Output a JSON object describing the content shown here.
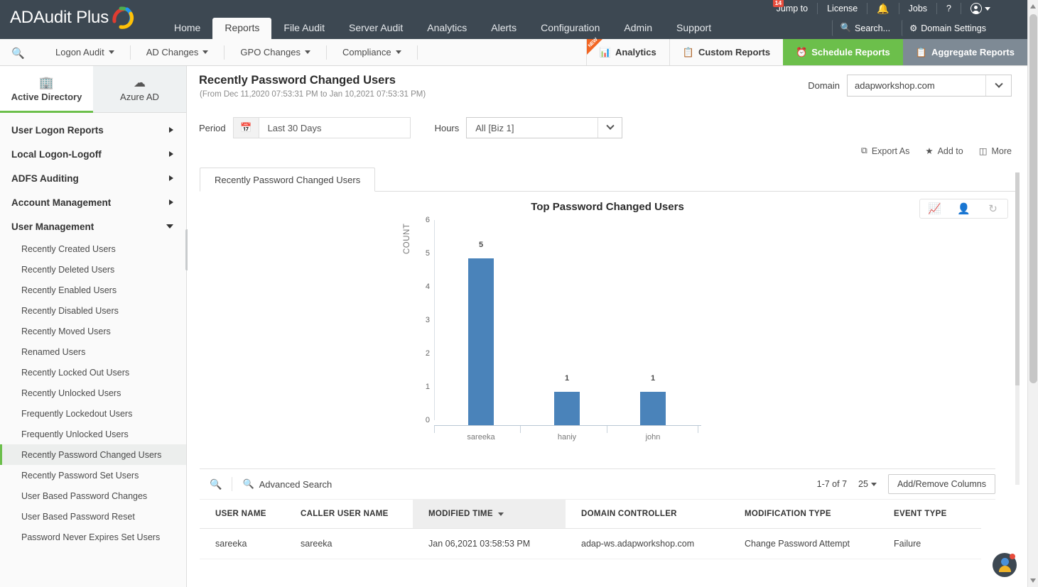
{
  "app": {
    "name": "ADAudit Plus"
  },
  "header": {
    "nav": [
      {
        "label": "Home",
        "active": false
      },
      {
        "label": "Reports",
        "active": true
      },
      {
        "label": "File Audit",
        "active": false
      },
      {
        "label": "Server Audit",
        "active": false
      },
      {
        "label": "Analytics",
        "active": false
      },
      {
        "label": "Alerts",
        "active": false
      },
      {
        "label": "Configuration",
        "active": false
      },
      {
        "label": "Admin",
        "active": false
      },
      {
        "label": "Support",
        "active": false
      }
    ],
    "utilities": [
      {
        "label": "Jump to"
      },
      {
        "label": "License"
      },
      {
        "label": "Jobs"
      },
      {
        "label": "?"
      }
    ],
    "notification_count": "14",
    "search_button": "Search...",
    "domain_settings_button": "Domain Settings"
  },
  "toolbar": {
    "menus": [
      {
        "label": "Logon Audit"
      },
      {
        "label": "AD Changes"
      },
      {
        "label": "GPO Changes"
      },
      {
        "label": "Compliance"
      }
    ],
    "right_items": [
      {
        "label": "Analytics",
        "badge": "NEW",
        "style": "plain"
      },
      {
        "label": "Custom Reports",
        "style": "plain"
      },
      {
        "label": "Schedule Reports",
        "style": "green"
      },
      {
        "label": "Aggregate Reports",
        "style": "grey"
      }
    ]
  },
  "sidebar": {
    "tabs": [
      {
        "label": "Active Directory",
        "active": true
      },
      {
        "label": "Azure AD",
        "active": false
      }
    ],
    "groups": [
      {
        "label": "User Logon Reports",
        "expanded": false
      },
      {
        "label": "Local Logon-Logoff",
        "expanded": false
      },
      {
        "label": "ADFS Auditing",
        "expanded": false
      },
      {
        "label": "Account Management",
        "expanded": false
      },
      {
        "label": "User Management",
        "expanded": true
      }
    ],
    "items": [
      {
        "label": "Recently Created Users",
        "active": false
      },
      {
        "label": "Recently Deleted Users",
        "active": false
      },
      {
        "label": "Recently Enabled Users",
        "active": false
      },
      {
        "label": "Recently Disabled Users",
        "active": false
      },
      {
        "label": "Recently Moved Users",
        "active": false
      },
      {
        "label": "Renamed Users",
        "active": false
      },
      {
        "label": "Recently Locked Out Users",
        "active": false
      },
      {
        "label": "Recently Unlocked Users",
        "active": false
      },
      {
        "label": "Frequently Lockedout Users",
        "active": false
      },
      {
        "label": "Frequently Unlocked Users",
        "active": false
      },
      {
        "label": "Recently Password Changed Users",
        "active": true
      },
      {
        "label": "Recently Password Set Users",
        "active": false
      },
      {
        "label": "User Based Password Changes",
        "active": false
      },
      {
        "label": "User Based Password Reset",
        "active": false
      },
      {
        "label": "Password Never Expires Set Users",
        "active": false
      }
    ]
  },
  "page": {
    "title": "Recently Password Changed Users",
    "subtitle": "(From Dec 11,2020 07:53:31 PM to Jan 10,2021 07:53:31 PM)",
    "domain_label": "Domain",
    "domain_value": "adapworkshop.com",
    "period_label": "Period",
    "period_value": "Last 30 Days",
    "hours_label": "Hours",
    "hours_value": "All [Biz 1]",
    "actions": [
      {
        "label": "Export As",
        "icon": "export-icon"
      },
      {
        "label": "Add to",
        "icon": "star-icon"
      },
      {
        "label": "More",
        "icon": "more-icon"
      }
    ],
    "card_tab": "Recently Password Changed Users"
  },
  "chart_data": {
    "type": "bar",
    "title": "Top Password Changed Users",
    "categories": [
      "sareeka",
      "haniy",
      "john"
    ],
    "values": [
      5,
      1,
      1
    ],
    "xlabel": "",
    "ylabel": "COUNT",
    "ylim": [
      0,
      6
    ],
    "yticks": [
      0,
      1,
      2,
      3,
      4,
      5,
      6
    ],
    "grid": false,
    "legend": "none",
    "bar_color": "#4a83ba",
    "data_labels": [
      "5",
      "1",
      "1"
    ]
  },
  "chart_tools": [
    {
      "icon": "add-chart-icon"
    },
    {
      "icon": "user-icon"
    },
    {
      "icon": "refresh-chart-icon"
    }
  ],
  "table": {
    "search_icon": "search-icon",
    "advanced_search": "Advanced Search",
    "count": "1-7 of 7",
    "page_size": "25",
    "add_remove_columns": "Add/Remove Columns",
    "columns": [
      {
        "label": "USER NAME",
        "sorted": false
      },
      {
        "label": "CALLER USER NAME",
        "sorted": false
      },
      {
        "label": "MODIFIED TIME",
        "sorted": true
      },
      {
        "label": "DOMAIN CONTROLLER",
        "sorted": false
      },
      {
        "label": "MODIFICATION TYPE",
        "sorted": false
      },
      {
        "label": "EVENT TYPE",
        "sorted": false
      }
    ],
    "rows": [
      {
        "user_name": "sareeka",
        "caller_user_name": "sareeka",
        "modified_time": "Jan 06,2021 03:58:53 PM",
        "domain_controller": "adap-ws.adapworkshop.com",
        "modification_type": "Change Password Attempt",
        "event_type": "Failure"
      }
    ]
  },
  "colors": {
    "header_bg": "#3d4852",
    "accent_green": "#6cbf4b",
    "bar_blue": "#4a83ba",
    "badge_red": "#e74c3c"
  }
}
